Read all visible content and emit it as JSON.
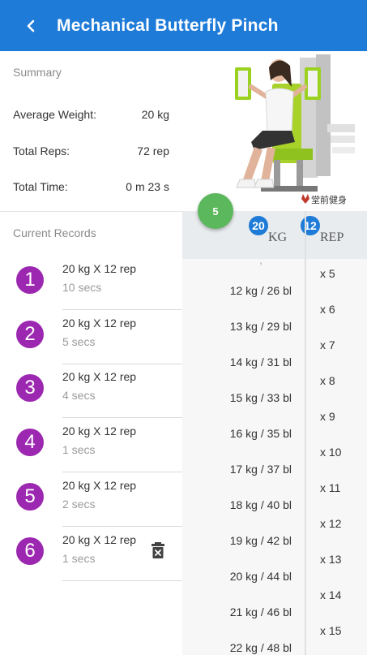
{
  "header": {
    "title": "Mechanical Butterfly Pinch",
    "back_icon": "chevron-left-icon"
  },
  "summary": {
    "label": "Summary",
    "rows": [
      {
        "label": "Average Weight:",
        "value": "20 kg"
      },
      {
        "label": "Total Reps:",
        "value": "72 rep"
      },
      {
        "label": "Total Time:",
        "value": "0 m 23 s"
      }
    ]
  },
  "records": {
    "label": "Current Records",
    "items": [
      {
        "index": "1",
        "main": "20 kg X 12 rep",
        "sub": "10 secs"
      },
      {
        "index": "2",
        "main": "20 kg X 12 rep",
        "sub": "5 secs"
      },
      {
        "index": "3",
        "main": "20 kg X 12 rep",
        "sub": "4 secs"
      },
      {
        "index": "4",
        "main": "20 kg X 12 rep",
        "sub": "1 secs"
      },
      {
        "index": "5",
        "main": "20 kg X 12 rep",
        "sub": "2 secs"
      },
      {
        "index": "6",
        "main": "20 kg X 12 rep",
        "sub": "1 secs"
      }
    ],
    "delete_icon": "delete-icon"
  },
  "exercise_image": {
    "watermark": "堂前健身"
  },
  "fab": {
    "label": "5"
  },
  "picker": {
    "kg_header": "KG",
    "kg_badge": "20",
    "rep_header": "REP",
    "rep_badge": "12",
    "kg_items": [
      "12 kg / 26 bl",
      "13 kg / 29 bl",
      "14 kg / 31 bl",
      "15 kg / 33 bl",
      "16 kg / 35 bl",
      "17 kg / 37 bl",
      "18 kg / 40 bl",
      "19 kg / 42 bl",
      "20 kg / 44 bl",
      "21 kg / 46 bl",
      "22 kg / 48 bl"
    ],
    "rep_items": [
      "x 5",
      "x 6",
      "x 7",
      "x 8",
      "x 9",
      "x 10",
      "x 11",
      "x 12",
      "x 13",
      "x 14",
      "x 15"
    ]
  },
  "colors": {
    "appbar": "#1e7bd8",
    "badge_purple": "#9c27b0",
    "fab_green": "#5cb85c",
    "picker_badge": "#1e7bd8"
  }
}
